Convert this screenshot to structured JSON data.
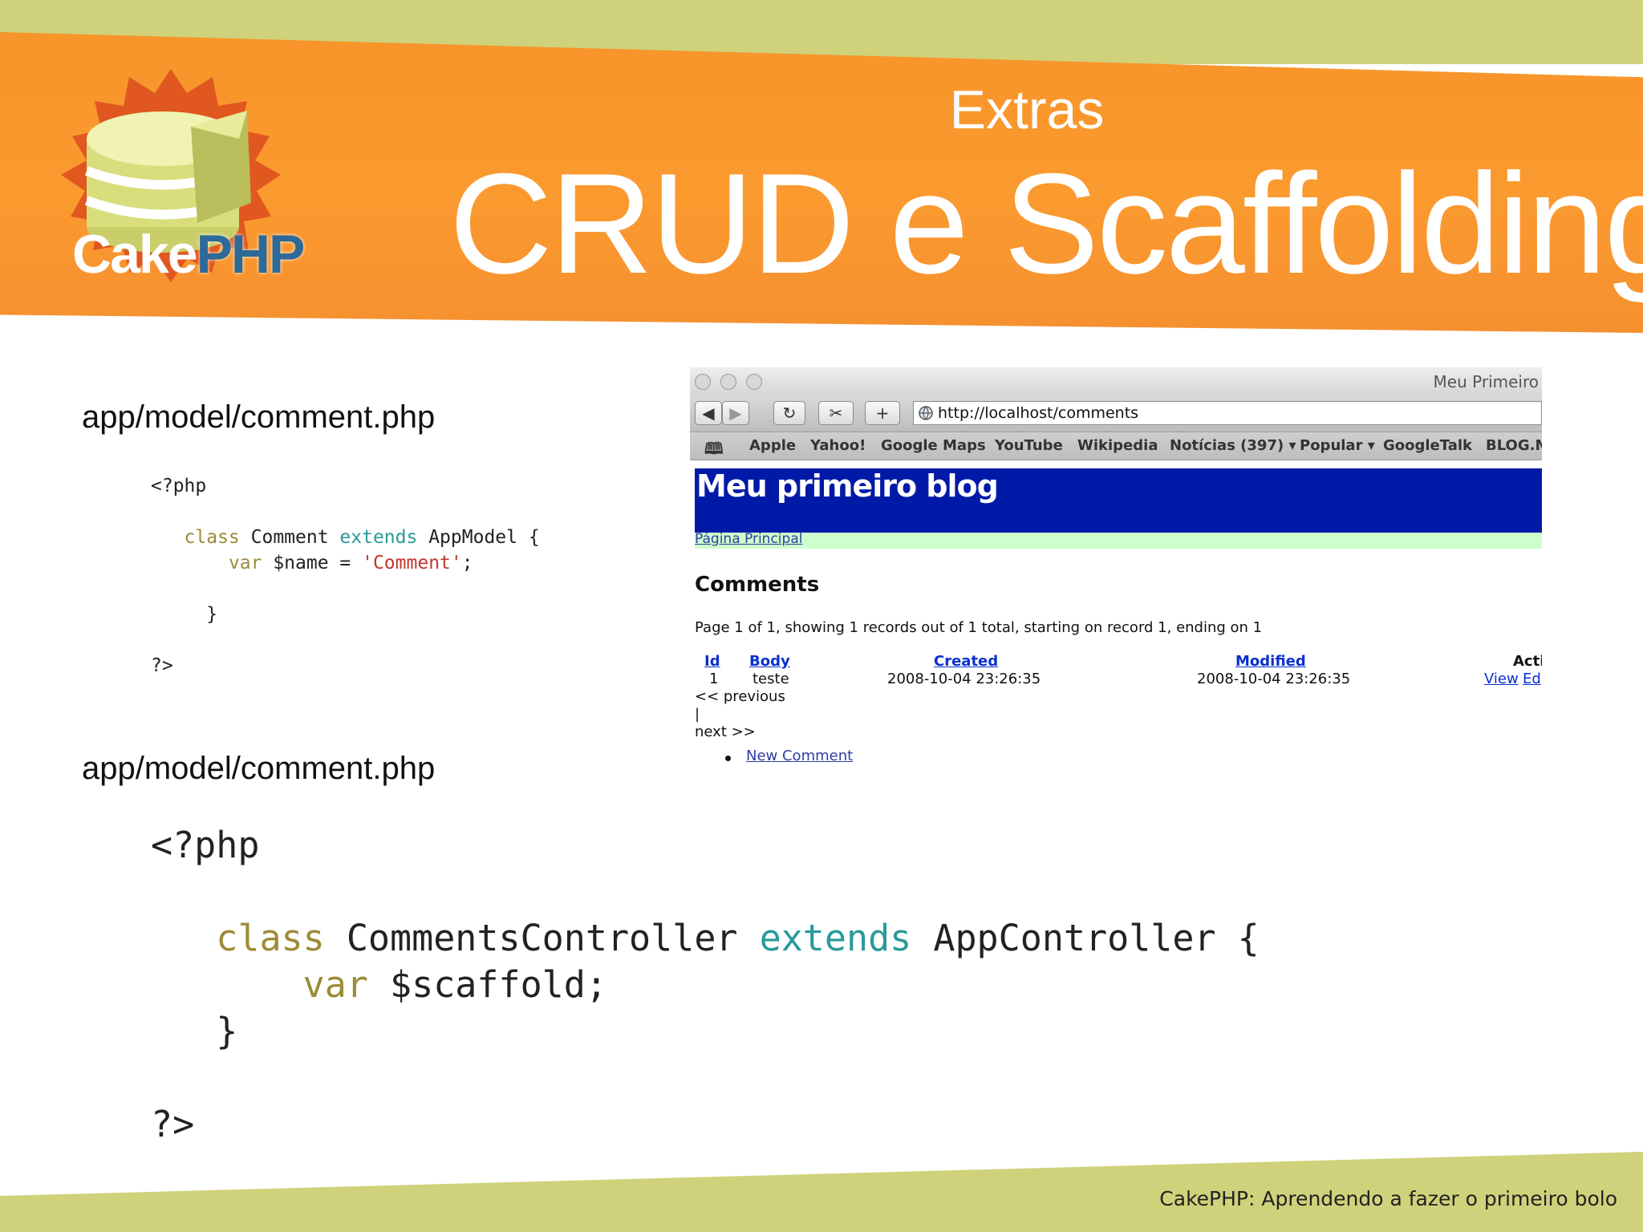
{
  "slide": {
    "logo_text_cake": "Cake",
    "logo_text_php": "PHP",
    "subtitle": "Extras",
    "title": "CRUD e Scaffolding",
    "path_label_1": "app/model/comment.php",
    "path_label_2": "app/model/comment.php",
    "footer": "CakePHP: Aprendendo a fazer o primeiro bolo"
  },
  "code_model": {
    "open_tag": "<?php",
    "class_kw": "class",
    "class_name": " Comment ",
    "extends_kw": "extends",
    "parent_open": " AppModel {",
    "var_kw": "var",
    "var_name": " $name = ",
    "var_value": "'Comment'",
    "semicolon": ";",
    "close_brace": "}",
    "close_tag": "?>"
  },
  "code_controller": {
    "open_tag": "<?php",
    "class_kw": "class",
    "class_name": " CommentsController ",
    "extends_kw": "extends",
    "parent_open": " AppController {",
    "var_kw": "var",
    "var_name": " $scaffold;",
    "close_brace": "}",
    "close_tag": "?>"
  },
  "browser": {
    "window_title": "Meu Primeiro",
    "url": "http://localhost/comments",
    "bookmarks": [
      "Apple",
      "Yahoo!",
      "Google Maps",
      "YouTube",
      "Wikipedia",
      "Notícias (397) ▾",
      "Popular ▾",
      "GoogleTalk",
      "BLOG.M"
    ],
    "toolbar_icons": [
      "back-icon",
      "forward-icon",
      "reload-icon",
      "snapback-icon",
      "add-bookmark-icon",
      "globe-icon",
      "bookmarks-book-icon"
    ],
    "page": {
      "blog_title": "Meu primeiro blog",
      "home_link": "Página Principal",
      "section_title": "Comments",
      "paging_text": "Page 1 of 1, showing 1 records out of 1 total, starting on record 1, ending on 1",
      "columns": [
        "Id",
        "Body",
        "Created",
        "Modified",
        "Acti"
      ],
      "rows": [
        {
          "id": "1",
          "body": "teste",
          "created": "2008-10-04 23:26:35",
          "modified": "2008-10-04 23:26:35",
          "view": "View",
          "edit": "Ed"
        }
      ],
      "prev": "<< previous",
      "separator": "|",
      "next": "next >>",
      "new_comment": "New Comment"
    }
  },
  "colors": {
    "orange": "#f7942a",
    "olive": "#cfd27a",
    "blog_header": "#001aa7",
    "nav_strip": "#ccffcc",
    "link_blue": "#0a2fd0"
  }
}
